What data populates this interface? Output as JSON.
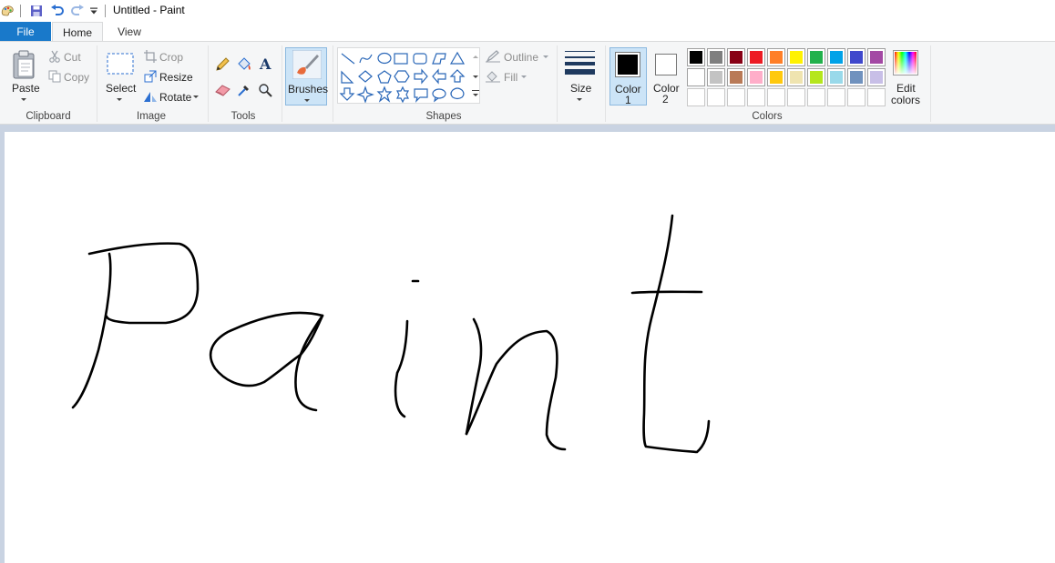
{
  "window": {
    "title": "Untitled - Paint"
  },
  "tabs": {
    "file": "File",
    "home": "Home",
    "view": "View"
  },
  "clipboard": {
    "paste": "Paste",
    "cut": "Cut",
    "copy": "Copy",
    "group_label": "Clipboard"
  },
  "image": {
    "select": "Select",
    "crop": "Crop",
    "resize": "Resize",
    "rotate": "Rotate",
    "group_label": "Image"
  },
  "tools": {
    "group_label": "Tools"
  },
  "brushes": {
    "label": "Brushes"
  },
  "shapes": {
    "outline": "Outline",
    "fill": "Fill",
    "group_label": "Shapes"
  },
  "size": {
    "label": "Size"
  },
  "colors": {
    "color1_line1": "Color",
    "color1_line2": "1",
    "color2_line1": "Color",
    "color2_line2": "2",
    "edit_line1": "Edit",
    "edit_line2": "colors",
    "group_label": "Colors",
    "color1_value": "#000000",
    "color2_value": "#ffffff",
    "palette_row1": [
      "#000000",
      "#7f7f7f",
      "#880015",
      "#ed1c24",
      "#ff7f27",
      "#fff200",
      "#22b14c",
      "#00a2e8",
      "#3f48cc",
      "#a349a4"
    ],
    "palette_row2": [
      "#ffffff",
      "#c3c3c3",
      "#b97a57",
      "#ffaec9",
      "#ffc90e",
      "#efe4b0",
      "#b5e61d",
      "#99d9ea",
      "#7092be",
      "#c8bfe7"
    ]
  },
  "accent_color": "#1979ca"
}
